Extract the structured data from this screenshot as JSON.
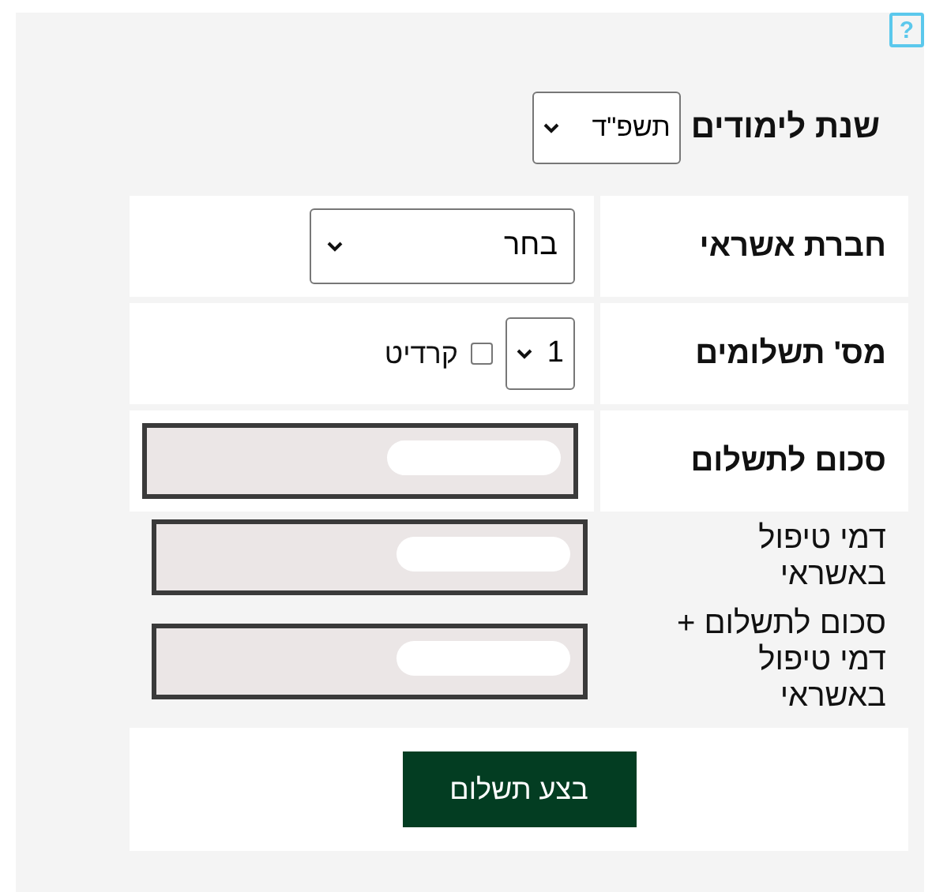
{
  "help": {
    "label": "?"
  },
  "year": {
    "label": "שנת לימודים",
    "value": "תשפ\"ד"
  },
  "rows": [
    {
      "kind": "select",
      "label": "חברת אשראי",
      "value": "בחר"
    },
    {
      "kind": "installments",
      "label": "מס' תשלומים",
      "value": "1",
      "credit": {
        "label": "קרדיט",
        "checked": false
      }
    },
    {
      "kind": "amount",
      "label": "סכום לתשלום",
      "redacted": true
    },
    {
      "kind": "amount_plain",
      "label": "דמי טיפול באשראי",
      "redacted": true
    },
    {
      "kind": "amount_plain",
      "label": "סכום לתשלום + דמי טיפול באשראי",
      "redacted": true
    }
  ],
  "submit": {
    "label": "בצע תשלום"
  }
}
